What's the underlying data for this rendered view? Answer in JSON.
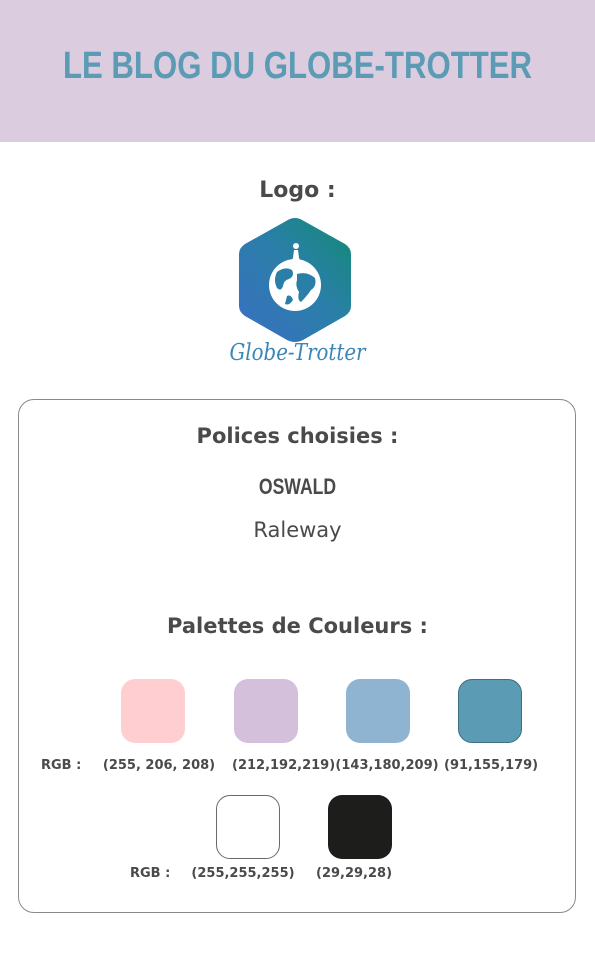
{
  "header": {
    "title": "LE BLOG DU GLOBE-TROTTER",
    "bg_color": "#dcccdf",
    "title_color": "#5b9bb3"
  },
  "logo": {
    "heading": "Logo :",
    "text": "Globe-Trotter",
    "icon": "hexagon-globe-hiker-icon"
  },
  "fonts": {
    "heading": "Polices choisies :",
    "primary": "OSWALD",
    "secondary": "Raleway"
  },
  "palette": {
    "heading": "Palettes de Couleurs :",
    "row1_prefix": "RGB :",
    "row2_prefix": "RGB :",
    "colors": [
      {
        "hex": "#ffced0",
        "rgb": "(255, 206, 208)"
      },
      {
        "hex": "#d4c0db",
        "rgb": "(212,192,219)"
      },
      {
        "hex": "#8fb4d1",
        "rgb": "(143,180,209)"
      },
      {
        "hex": "#5b9bb3",
        "rgb": "(91,155,179)"
      },
      {
        "hex": "#ffffff",
        "rgb": "(255,255,255)"
      },
      {
        "hex": "#1d1d1c",
        "rgb": "(29,29,28)"
      }
    ]
  }
}
